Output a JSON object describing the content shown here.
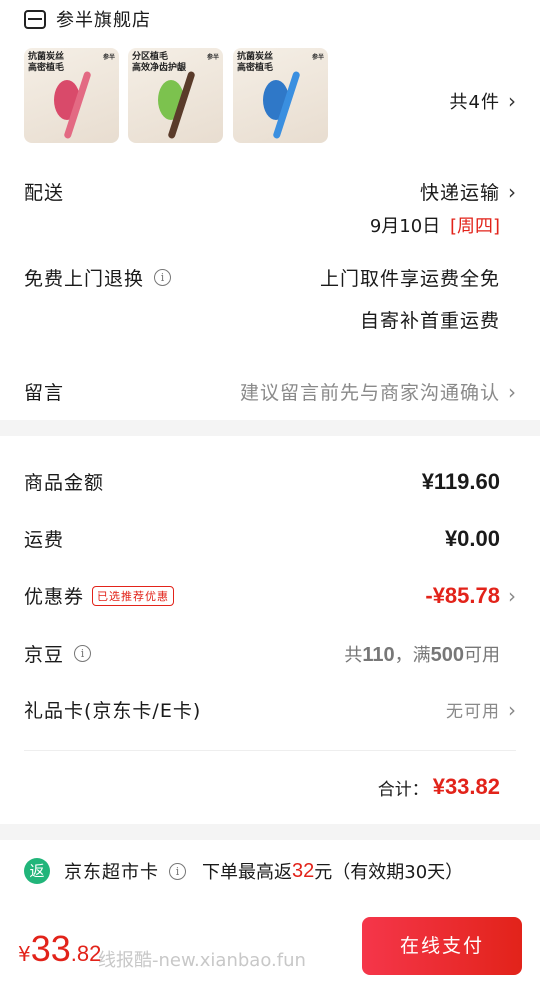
{
  "shop": {
    "name": "参半旗舰店",
    "count_text": "共4件"
  },
  "products": [
    {
      "line1": "抗菌炭丝",
      "line2": "高密植毛",
      "brand": "参半",
      "color": "#d94a6a"
    },
    {
      "line1": "分区植毛",
      "line2": "高效净齿护龈",
      "brand": "参半",
      "color": "#7cc24e"
    },
    {
      "line1": "抗菌炭丝",
      "line2": "高密植毛",
      "brand": "参半",
      "color": "#2f78c8"
    }
  ],
  "delivery": {
    "label": "配送",
    "method": "快递运输",
    "date": "9月10日",
    "weekday": "[周四]"
  },
  "returns": {
    "label": "免费上门退换",
    "line1": "上门取件享运费全免",
    "line2": "自寄补首重运费"
  },
  "message": {
    "label": "留言",
    "placeholder": "建议留言前先与商家沟通确认"
  },
  "fees": {
    "goods_label": "商品金额",
    "goods_value": "¥119.60",
    "shipping_label": "运费",
    "shipping_value": "¥0.00",
    "coupon_label": "优惠券",
    "coupon_badge": "已选推荐优惠",
    "coupon_value": "-¥85.78",
    "jingdou_label": "京豆",
    "jingdou_prefix": "共",
    "jingdou_have": "110",
    "jingdou_mid": "，满",
    "jingdou_need": "500",
    "jingdou_suffix": "可用",
    "giftcard_label": "礼品卡(京东卡/E卡)",
    "giftcard_value": "无可用",
    "total_label": "合计：",
    "total_value": "¥33.82"
  },
  "rebate": {
    "icon_text": "返",
    "card_name": "京东超市卡",
    "text1": "下单最高返",
    "amount": "32",
    "text2": "元（有效期30天）"
  },
  "bottom": {
    "currency": "¥",
    "price_int": "33",
    "price_dec": ".82",
    "pay_label": "在线支付",
    "watermark": "线报酷-new.xianbao.fun"
  },
  "colors": {
    "accent": "#e2231a",
    "pay_button": "#f5364a"
  }
}
